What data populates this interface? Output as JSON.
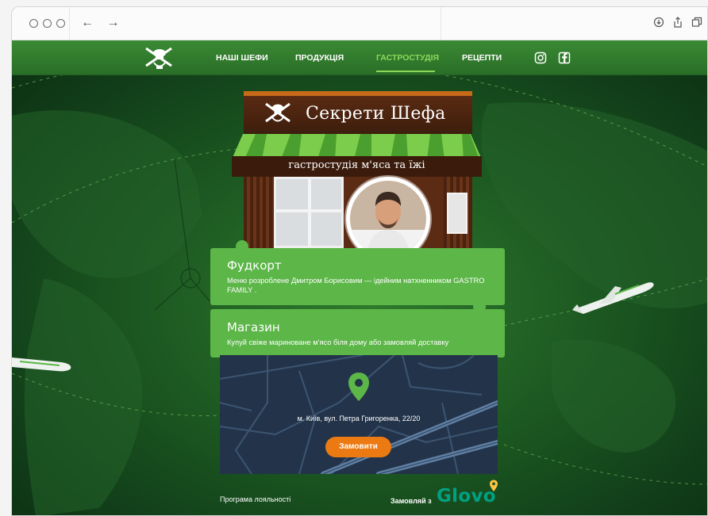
{
  "browser": {
    "nav_arrows": "← →"
  },
  "site": {
    "menu": [
      {
        "label": "НАШІ ШЕФИ",
        "active": false
      },
      {
        "label": "ПРОДУКЦІЯ",
        "active": false
      },
      {
        "label": "ГАСТРОСТУДІЯ",
        "active": true
      },
      {
        "label": "РЕЦЕПТИ",
        "active": false
      }
    ],
    "social": [
      "instagram-icon",
      "facebook-icon"
    ]
  },
  "store": {
    "title": "Секрети Шефа",
    "subtitle": "гастростудія м'яса та їжі"
  },
  "cards": [
    {
      "title": "Фудкорт",
      "text": "Меню розроблене Дмитром Борисовим — ідейним натхненником GASTRO FAMILY ."
    },
    {
      "title": "Магазин",
      "text": "Купуй свіже мариноване м'ясо біля дому або замовляй доставку"
    }
  ],
  "map": {
    "address": "м. Київ, вул. Петра Григоренка, 22/20",
    "order_button": "Замовити"
  },
  "footer": {
    "loyalty": "Програма лояльності",
    "order_with": "Замовляй з",
    "glovo": "Glovo"
  },
  "colors": {
    "accent_green": "#5cb648",
    "active_menu": "#8dd65a",
    "order_button": "#ec7a12",
    "glovo": "#00a082"
  }
}
